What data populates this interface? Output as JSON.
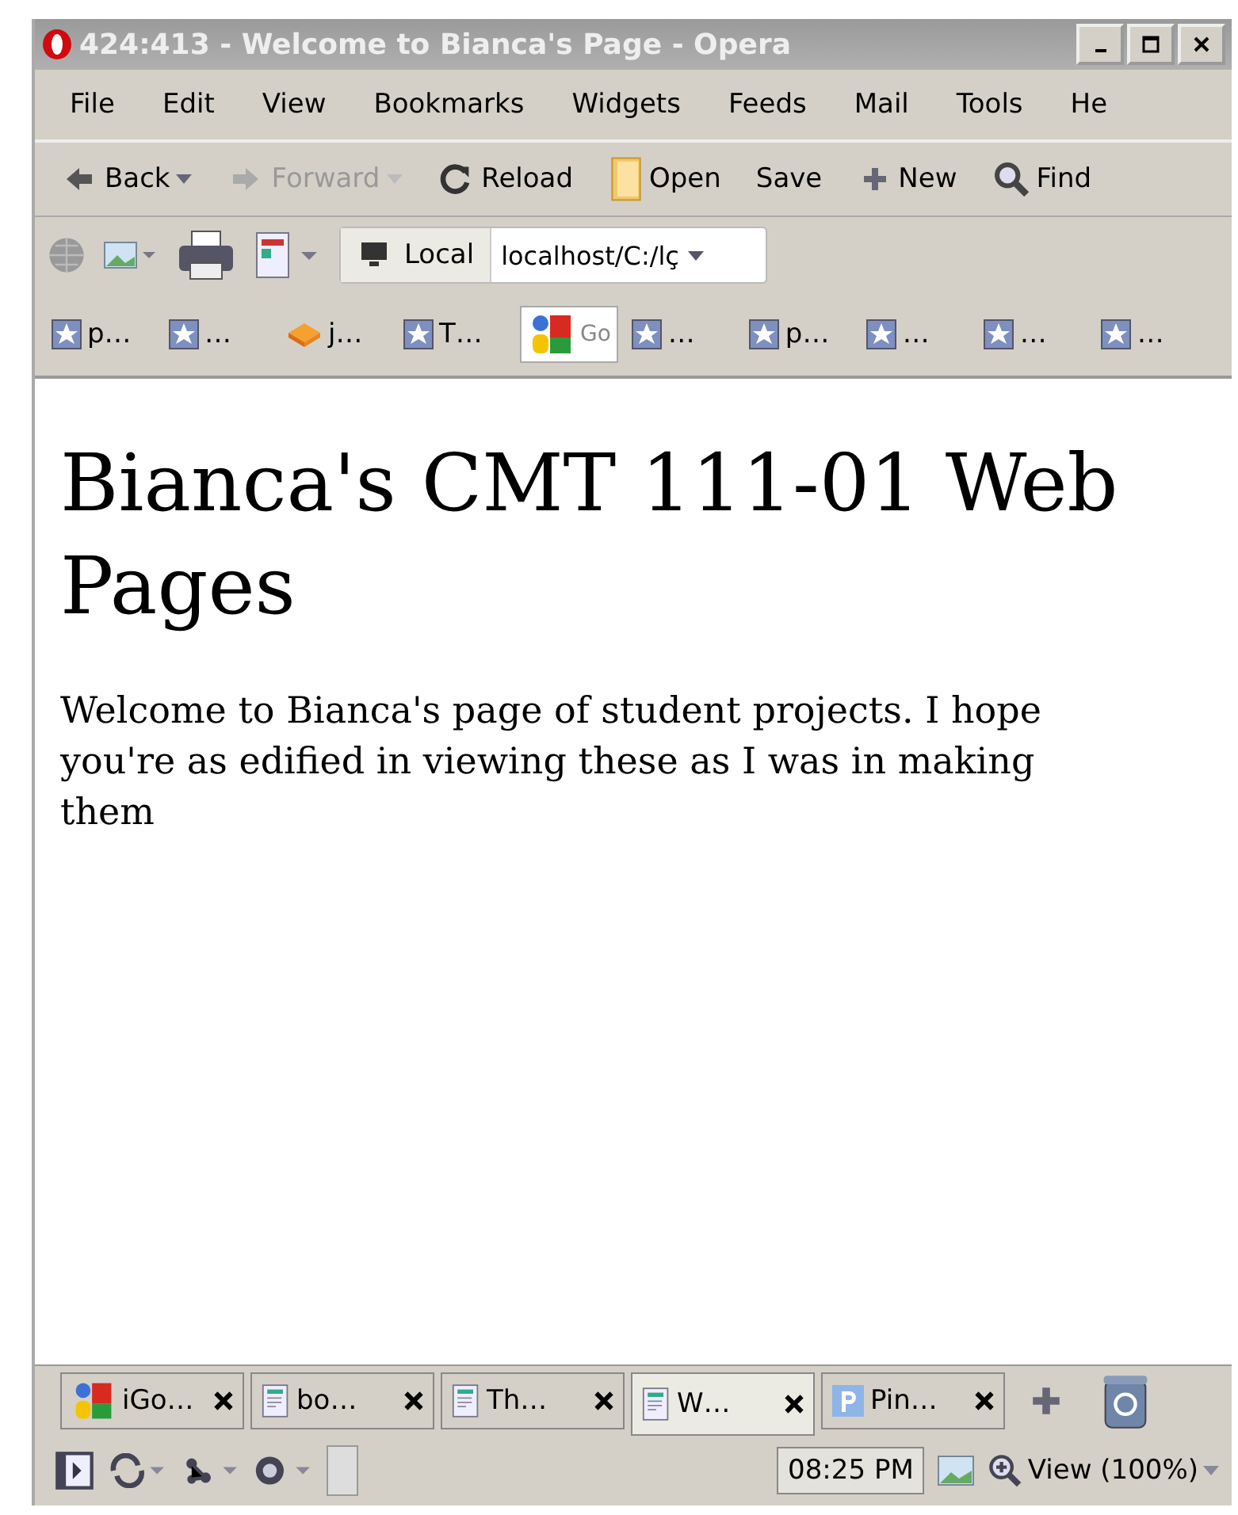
{
  "window": {
    "title": "424:413 - Welcome to Bianca's Page - Opera"
  },
  "menu": [
    "File",
    "Edit",
    "View",
    "Bookmarks",
    "Widgets",
    "Feeds",
    "Mail",
    "Tools",
    "He"
  ],
  "toolbar": [
    {
      "label": "Back",
      "kind": "back",
      "disabled": false,
      "dropdown": true
    },
    {
      "label": "Forward",
      "kind": "forward",
      "disabled": true,
      "dropdown": true
    },
    {
      "label": "Reload",
      "kind": "reload",
      "disabled": false,
      "dropdown": false
    },
    {
      "label": "Open",
      "kind": "open",
      "disabled": false,
      "dropdown": false
    },
    {
      "label": "Save",
      "kind": "save",
      "disabled": false,
      "dropdown": false
    },
    {
      "label": "New",
      "kind": "new",
      "disabled": false,
      "dropdown": false
    },
    {
      "label": "Find",
      "kind": "find",
      "disabled": false,
      "dropdown": false
    }
  ],
  "address": {
    "zone": "Local",
    "url": "localhost/C:/lç"
  },
  "bookmarks": [
    {
      "label": "p…",
      "kind": "star"
    },
    {
      "label": "…",
      "kind": "star"
    },
    {
      "label": "j…",
      "kind": "orange"
    },
    {
      "label": "T…",
      "kind": "star"
    },
    {
      "label": "Go",
      "kind": "google"
    },
    {
      "label": "…",
      "kind": "star"
    },
    {
      "label": "p…",
      "kind": "star"
    },
    {
      "label": "…",
      "kind": "star"
    },
    {
      "label": "…",
      "kind": "star"
    },
    {
      "label": "…",
      "kind": "star"
    }
  ],
  "page": {
    "heading": "Bianca's CMT 111-01 Web Pages",
    "text": "Welcome to Bianca's page of student projects. I hope you're as edified in viewing these as I was in making them"
  },
  "tabs": [
    {
      "label": "iGo…",
      "kind": "google",
      "selected": false
    },
    {
      "label": "bo…",
      "kind": "page",
      "selected": false
    },
    {
      "label": "Th…",
      "kind": "page",
      "selected": false
    },
    {
      "label": "W…",
      "kind": "page",
      "selected": true
    },
    {
      "label": "Pin…",
      "kind": "p",
      "selected": false
    }
  ],
  "status": {
    "time": "08:25 PM",
    "view": "View (100%)"
  }
}
